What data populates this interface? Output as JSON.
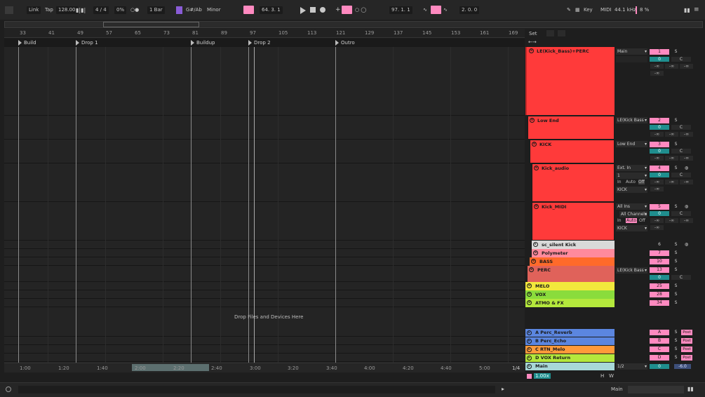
{
  "transport": {
    "link": "Link",
    "tap": "Tap",
    "tempo": "128.00",
    "signature": "4 / 4",
    "swing": "0%",
    "quantize": "1 Bar",
    "key": "G#/Ab",
    "scale": "Minor",
    "position": "64.  3.  1",
    "loop_start": "97.  1.  1",
    "loop_length": "2.  0.  0",
    "key_btn": "Key",
    "midi_btn": "MIDI",
    "sample_rate": "44.1 kHz",
    "cpu": "8 %"
  },
  "ruler": {
    "bars": [
      "33",
      "41",
      "49",
      "57",
      "65",
      "73",
      "81",
      "89",
      "97",
      "105",
      "113",
      "121",
      "129",
      "137",
      "145",
      "153",
      "161",
      "169"
    ]
  },
  "locators": [
    "Build",
    "Drop 1",
    "Buildup",
    "Drop 2",
    "Outro"
  ],
  "arrangement": {
    "drop_message": "Drop Files and Devices Here"
  },
  "time_ruler": {
    "ticks": [
      "1:00",
      "1:20",
      "1:40",
      "2:00",
      "2:20",
      "2:40",
      "3:00",
      "3:20",
      "3:40",
      "4:00",
      "4:20",
      "4:40",
      "5:00"
    ],
    "zoom": "1/4"
  },
  "mixer": {
    "set_label": "Set",
    "minus_inf": "-∞",
    "tracks": [
      {
        "name": "LE(Kick_Bass)+PERC",
        "color": "#ff3a3a",
        "io": "Main",
        "num": "1",
        "vol": "0",
        "pan": "C"
      },
      {
        "name": "Low End",
        "color": "#ff3a3a",
        "io": "LE(Kick Bass",
        "num": "2",
        "vol": "0",
        "pan": "C"
      },
      {
        "name": "KICK",
        "color": "#ff3a3a",
        "io": "Low End",
        "num": "3",
        "vol": "0",
        "pan": "C"
      },
      {
        "name": "Kick_audio",
        "color": "#ff3a3a",
        "io": "Ext. In",
        "io2": "1",
        "io3": "KICK",
        "num": "4",
        "vol": "0",
        "pan": "C",
        "mon": [
          "In",
          "Auto",
          "Off"
        ]
      },
      {
        "name": "Kick_MIDI",
        "color": "#ff3a3a",
        "io": "All Ins",
        "io2": "All Channels",
        "io3": "KICK",
        "num": "5",
        "vol": "0",
        "pan": "C",
        "mon": [
          "In",
          "Auto",
          "Off"
        ]
      },
      {
        "name": "sc_silent Kick",
        "color": "#d9d9d9",
        "num": "6"
      },
      {
        "name": "Polymeter",
        "color": "#ff8a9c",
        "num": "7"
      },
      {
        "name": "BASS",
        "color": "#ff6a2a",
        "num": "10"
      },
      {
        "name": "PERC",
        "color": "#e0625a",
        "io": "LE(Kick Bass",
        "num": "13",
        "vol": "0",
        "pan": "C"
      },
      {
        "name": "MELO",
        "color": "#f2e83c",
        "num": "25"
      },
      {
        "name": "VOX",
        "color": "#8adc3c",
        "num": "28"
      },
      {
        "name": "ATMO & FX",
        "color": "#b4e83c",
        "num": "34"
      }
    ],
    "returns": [
      {
        "name": "A Perc_Reverb",
        "color": "#5b86e0",
        "num": "A",
        "post": "Post"
      },
      {
        "name": "B Perc_Echo",
        "color": "#5b86e0",
        "num": "B",
        "post": "Post"
      },
      {
        "name": "C RTN_Melo",
        "color": "#ff9a3a",
        "num": "C",
        "post": "Post"
      },
      {
        "name": "D VOX Return",
        "color": "#b4e83c",
        "num": "D",
        "post": "Post"
      }
    ],
    "main": {
      "name": "Main",
      "color": "#a8d8d8",
      "io": "1/2",
      "vol": "0",
      "level": "-6.0"
    },
    "zoom_readout": "1.00x"
  },
  "bottom": {
    "main_label": "Main",
    "h": "H",
    "w": "W"
  },
  "colors": {
    "accent_pink": "#ff8ac0",
    "teal": "#1f8e8e",
    "red": "#ff3a3a"
  }
}
